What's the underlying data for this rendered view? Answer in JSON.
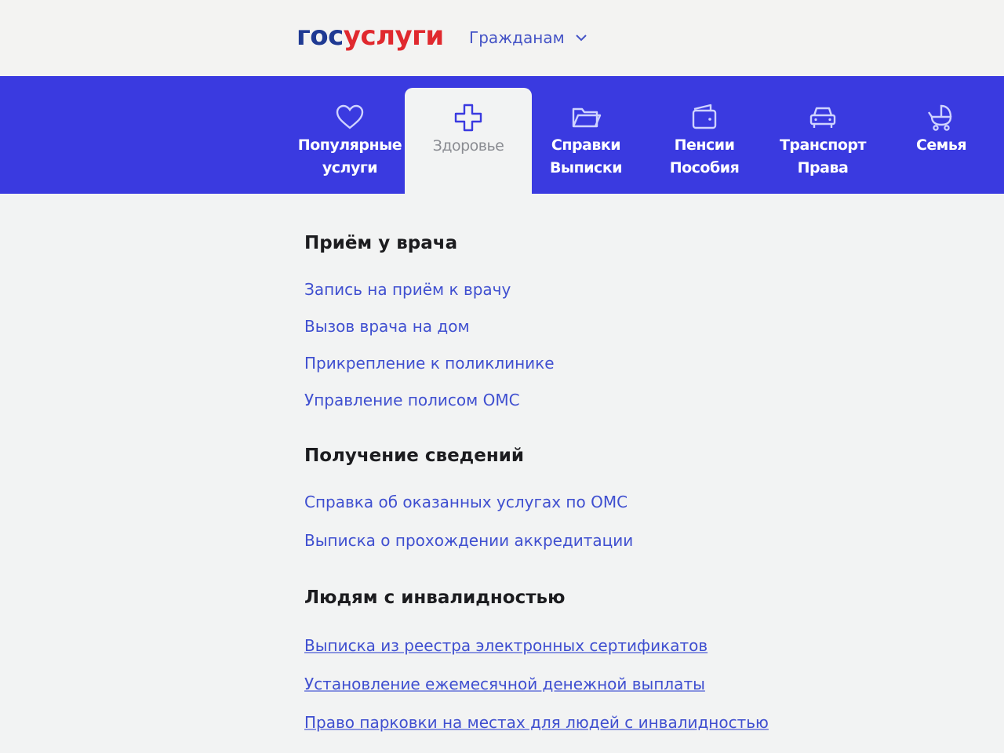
{
  "header": {
    "logo_part1": "гос",
    "logo_part2": "услуги",
    "audience_label": "Гражданам"
  },
  "nav": {
    "items": [
      {
        "label": "Популярные\nуслуги",
        "icon": "heart-icon"
      },
      {
        "label": "Здоровье",
        "icon": "medical-cross-icon",
        "active": true
      },
      {
        "label": "Справки\nВыписки",
        "icon": "folder-icon"
      },
      {
        "label": "Пенсии\nПособия",
        "icon": "wallet-icon"
      },
      {
        "label": "Транспорт\nПрава",
        "icon": "car-icon"
      },
      {
        "label": "Семья",
        "icon": "stroller-icon"
      }
    ]
  },
  "sections": [
    {
      "title": "Приём у врача",
      "links": [
        "Запись на приём к врачу",
        "Вызов врача на дом",
        "Прикрепление к поликлинике",
        "Управление полисом ОМС"
      ]
    },
    {
      "title": "Получение сведений",
      "links": [
        "Справка об оказанных услугах по ОМС",
        "Выписка о прохождении аккредитации"
      ]
    },
    {
      "title": "Людям с инвалидностью",
      "links": [
        "Выписка из реестра электронных сертификатов",
        "Установление ежемесячной денежной выплаты",
        "Право парковки на местах для людей с инвалидностью"
      ]
    }
  ],
  "colors": {
    "brand_blue": "#3a3ae0",
    "logo_blue": "#1f3a93",
    "logo_red": "#e0292e",
    "link": "#3f4fd0"
  }
}
